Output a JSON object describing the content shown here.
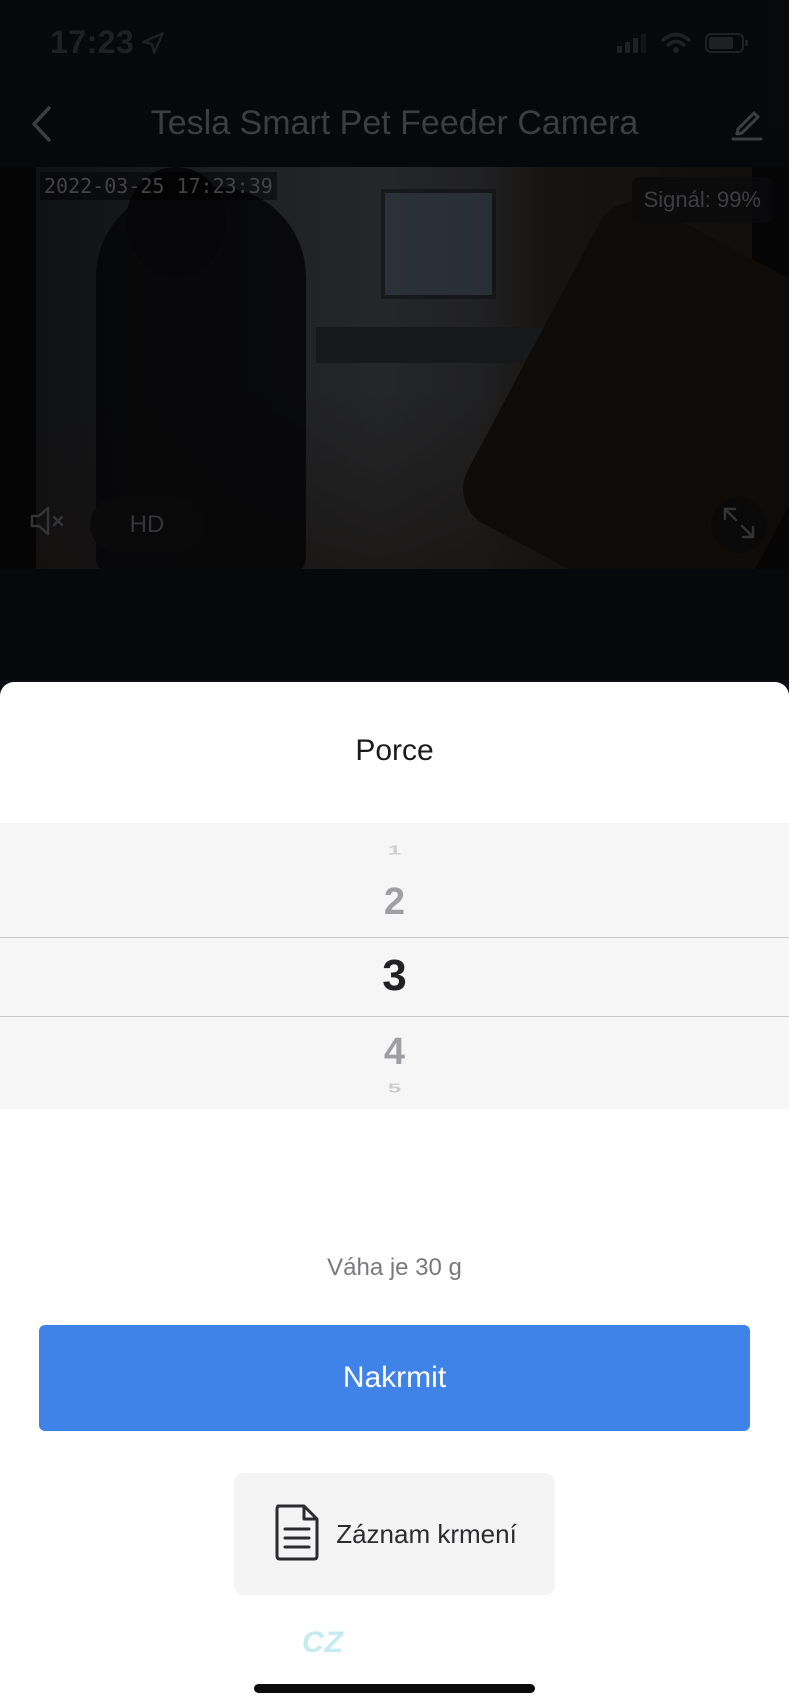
{
  "status_bar": {
    "time": "17:23",
    "location_icon": "location-arrow-icon",
    "icons": [
      "cellular-signal-icon",
      "wifi-icon",
      "battery-icon"
    ]
  },
  "nav": {
    "title": "Tesla Smart Pet Feeder Camera",
    "back_icon": "chevron-left-icon",
    "edit_icon": "edit-pencil-icon"
  },
  "camera": {
    "timestamp": "2022-03-25 17:23:39",
    "signal": "Signál: 99%",
    "quality_label": "HD",
    "mute_icon": "speaker-muted-icon",
    "fullscreen_icon": "expand-icon"
  },
  "sheet": {
    "title": "Porce",
    "picker": {
      "items": [
        "1",
        "2",
        "3",
        "4",
        "5"
      ],
      "selected": "3"
    },
    "weight_text": "Váha  je 30 g",
    "feed_button": "Nakrmit",
    "log_button": "Záznam krmení",
    "log_icon": "document-icon",
    "watermark": "CZ"
  },
  "colors": {
    "primary": "#3f83e9",
    "background_dark": "#0e1016",
    "sheet_background": "#ffffff",
    "picker_background": "#f6f6f6"
  }
}
